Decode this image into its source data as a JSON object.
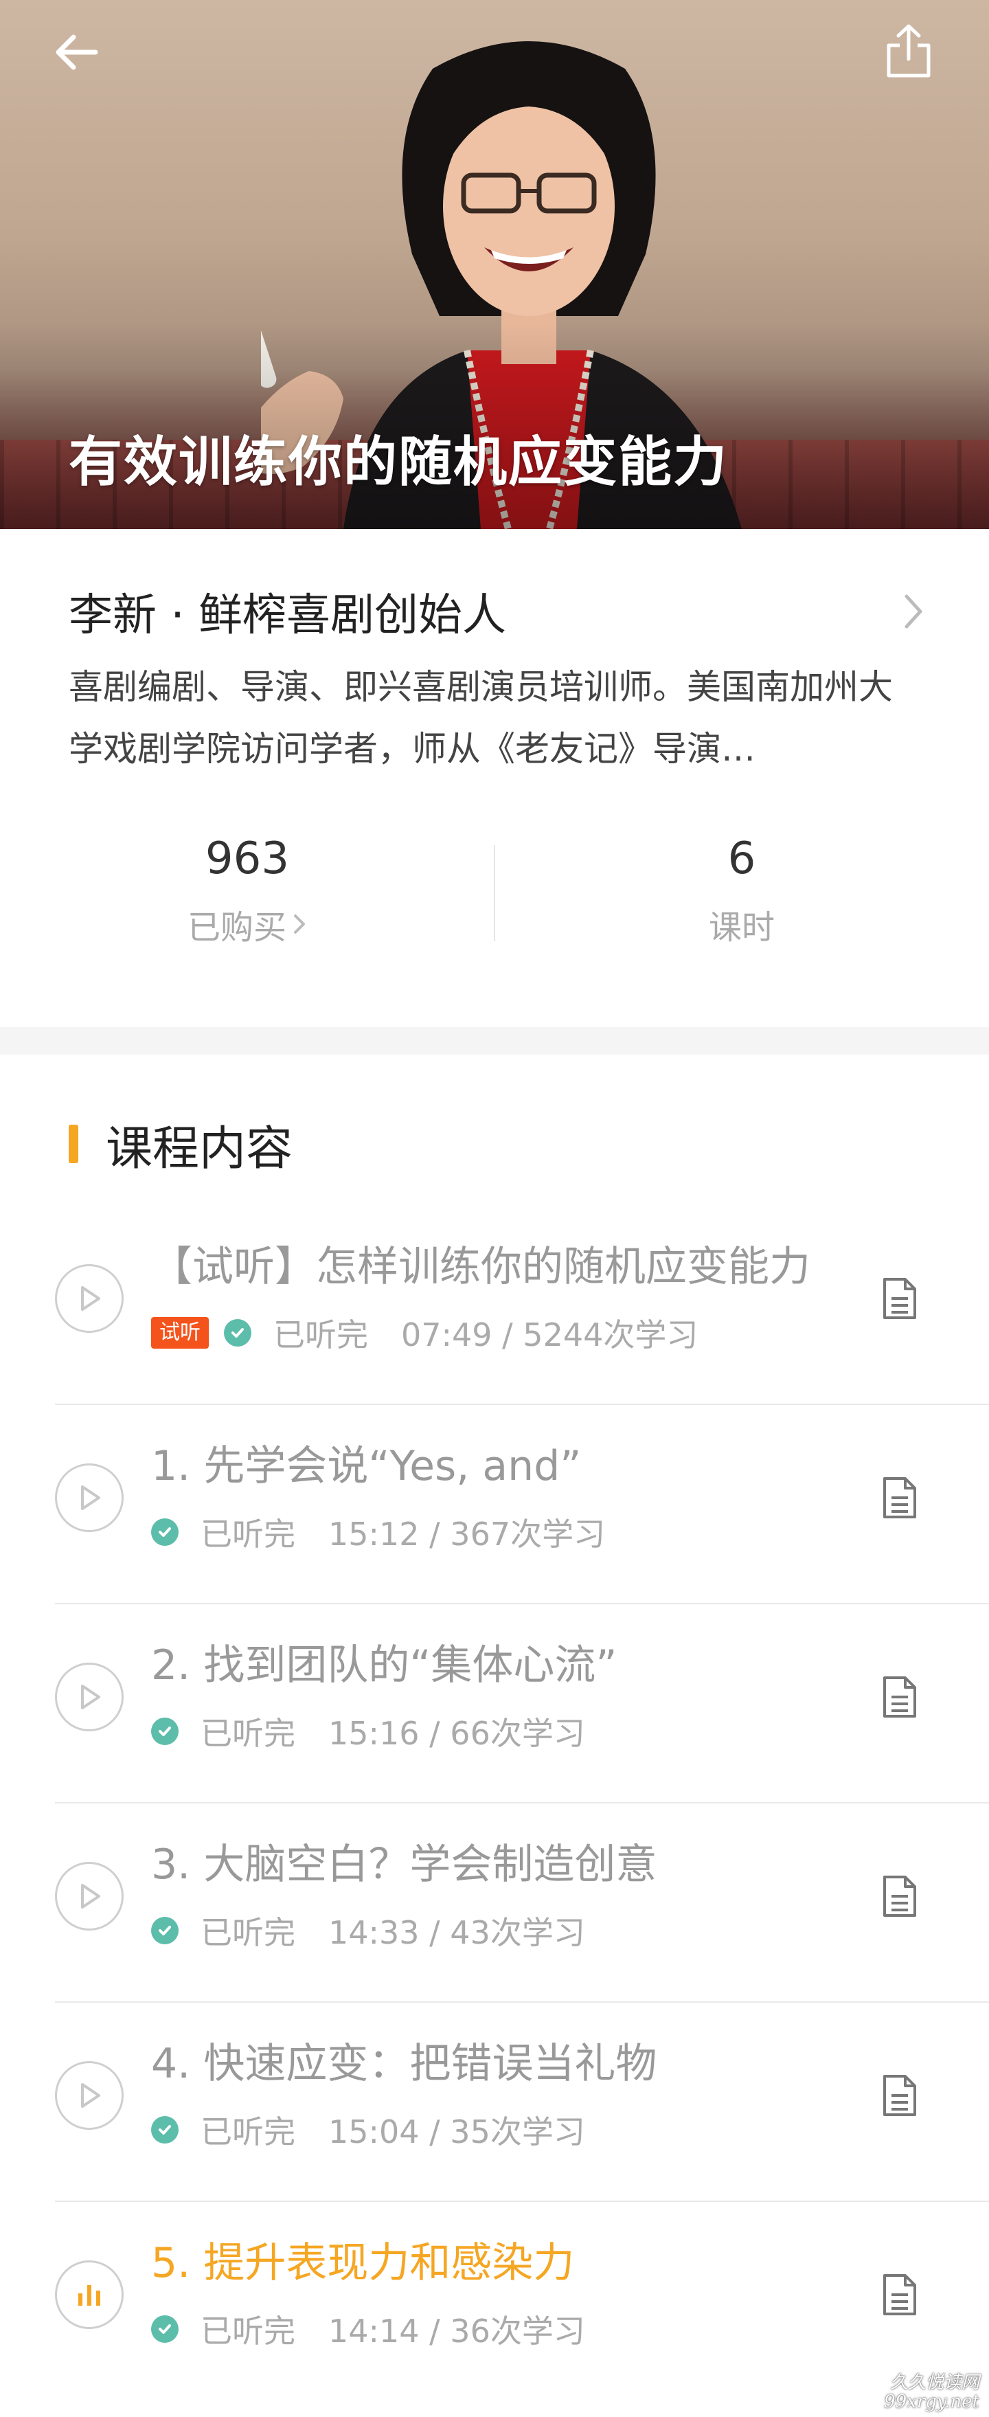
{
  "hero": {
    "title": "有效训练你的随机应变能力",
    "back_icon": "arrow-left-icon",
    "share_icon": "share-icon"
  },
  "author": {
    "name": "李新 · 鲜榨喜剧创始人",
    "bio": "喜剧编剧、导演、即兴喜剧演员培训师。美国南加州大学戏剧学院访问学者，师从《老友记》导演…",
    "chevron_icon": "chevron-right-icon"
  },
  "stats": {
    "purchased_count": "963",
    "purchased_label": "已购买",
    "lessons_count": "6",
    "lessons_label": "课时"
  },
  "course": {
    "section_title": "课程内容",
    "accent_color": "#f5a623",
    "lessons": [
      {
        "title": "【试听】怎样训练你的随机应变能力",
        "badge": "试听",
        "status": "已听完",
        "meta": "07:49 / 5244次学习"
      },
      {
        "title": "1. 先学会说“Yes, and”",
        "status": "已听完",
        "meta": "15:12 / 367次学习"
      },
      {
        "title": "2. 找到团队的“集体心流”",
        "status": "已听完",
        "meta": "15:16 / 66次学习"
      },
      {
        "title": "3. 大脑空白？学会制造创意",
        "status": "已听完",
        "meta": "14:33 / 43次学习"
      },
      {
        "title": "4. 快速应变：把错误当礼物",
        "status": "已听完",
        "meta": "15:04 / 35次学习"
      },
      {
        "title": "5. 提升表现力和感染力",
        "status": "已听完",
        "meta": "14:14 / 36次学习"
      }
    ]
  },
  "watermark": {
    "line1": "久久悦读网",
    "line2": "99xrgy.net"
  }
}
